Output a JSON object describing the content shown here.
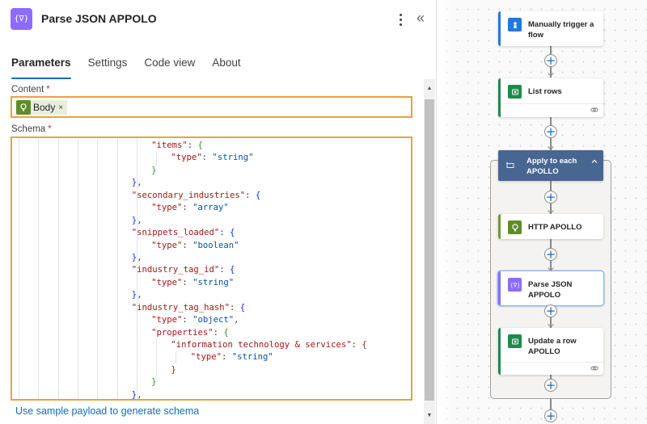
{
  "panel": {
    "title": "Parse JSON APPOLO",
    "icon": "braces-variable-icon",
    "more_icon": "more-vertical-icon",
    "collapse_icon": "double-chevron-left-icon",
    "collapse_glyph": "«",
    "tabs": [
      {
        "label": "Parameters",
        "active": true
      },
      {
        "label": "Settings",
        "active": false
      },
      {
        "label": "Code view",
        "active": false
      },
      {
        "label": "About",
        "active": false
      }
    ],
    "content": {
      "label": "Content",
      "required_mark": "*",
      "token": {
        "label": "Body",
        "remove": "×",
        "icon": "http-globe-icon"
      }
    },
    "schema": {
      "label": "Schema",
      "required_mark": "*",
      "lines": [
        {
          "indent": 7,
          "parts": [
            [
              "k",
              "\"items\""
            ],
            [
              "p",
              ": "
            ],
            [
              "b2",
              "{"
            ]
          ]
        },
        {
          "indent": 8,
          "parts": [
            [
              "k",
              "\"type\""
            ],
            [
              "p",
              ": "
            ],
            [
              "s",
              "\"string\""
            ]
          ]
        },
        {
          "indent": 7,
          "parts": [
            [
              "b2",
              "}"
            ]
          ]
        },
        {
          "indent": 6,
          "parts": [
            [
              "b1",
              "}"
            ],
            [
              "p",
              ","
            ]
          ]
        },
        {
          "indent": 6,
          "parts": [
            [
              "k",
              "\"secondary_industries\""
            ],
            [
              "p",
              ": "
            ],
            [
              "b1",
              "{"
            ]
          ]
        },
        {
          "indent": 7,
          "parts": [
            [
              "k",
              "\"type\""
            ],
            [
              "p",
              ": "
            ],
            [
              "s",
              "\"array\""
            ]
          ]
        },
        {
          "indent": 6,
          "parts": [
            [
              "b1",
              "}"
            ],
            [
              "p",
              ","
            ]
          ]
        },
        {
          "indent": 6,
          "parts": [
            [
              "k",
              "\"snippets_loaded\""
            ],
            [
              "p",
              ": "
            ],
            [
              "b1",
              "{"
            ]
          ]
        },
        {
          "indent": 7,
          "parts": [
            [
              "k",
              "\"type\""
            ],
            [
              "p",
              ": "
            ],
            [
              "s",
              "\"boolean\""
            ]
          ]
        },
        {
          "indent": 6,
          "parts": [
            [
              "b1",
              "}"
            ],
            [
              "p",
              ","
            ]
          ]
        },
        {
          "indent": 6,
          "parts": [
            [
              "k",
              "\"industry_tag_id\""
            ],
            [
              "p",
              ": "
            ],
            [
              "b1",
              "{"
            ]
          ]
        },
        {
          "indent": 7,
          "parts": [
            [
              "k",
              "\"type\""
            ],
            [
              "p",
              ": "
            ],
            [
              "s",
              "\"string\""
            ]
          ]
        },
        {
          "indent": 6,
          "parts": [
            [
              "b1",
              "}"
            ],
            [
              "p",
              ","
            ]
          ]
        },
        {
          "indent": 6,
          "parts": [
            [
              "k",
              "\"industry_tag_hash\""
            ],
            [
              "p",
              ": "
            ],
            [
              "b1",
              "{"
            ]
          ]
        },
        {
          "indent": 7,
          "parts": [
            [
              "k",
              "\"type\""
            ],
            [
              "p",
              ": "
            ],
            [
              "s",
              "\"object\""
            ],
            [
              "p",
              ","
            ]
          ]
        },
        {
          "indent": 7,
          "parts": [
            [
              "k",
              "\"properties\""
            ],
            [
              "p",
              ": "
            ],
            [
              "b2",
              "{"
            ]
          ]
        },
        {
          "indent": 8,
          "parts": [
            [
              "k",
              "\"information technology & services\""
            ],
            [
              "p",
              ": "
            ],
            [
              "b3",
              "{"
            ]
          ]
        },
        {
          "indent": 9,
          "parts": [
            [
              "k",
              "\"type\""
            ],
            [
              "p",
              ": "
            ],
            [
              "s",
              "\"string\""
            ]
          ]
        },
        {
          "indent": 8,
          "parts": [
            [
              "b3",
              "}"
            ]
          ]
        },
        {
          "indent": 7,
          "parts": [
            [
              "b2",
              "}"
            ]
          ]
        },
        {
          "indent": 6,
          "parts": [
            [
              "b1",
              "}"
            ],
            [
              "p",
              ","
            ]
          ]
        }
      ]
    },
    "generate_link": "Use sample payload to generate schema",
    "scrollbar": {
      "up": "▲",
      "down": "▼"
    }
  },
  "flow": {
    "nodes": [
      {
        "id": "trigger",
        "title": "Manually trigger a flow",
        "icon": "manual-trigger-icon",
        "accent": "#1f7ae0",
        "icon_bg": "#1f7ae0",
        "has_footer": false
      },
      {
        "id": "list-rows",
        "title": "List rows",
        "icon": "excel-icon",
        "accent": "#1e8a4c",
        "icon_bg": "#1e8a4c",
        "has_footer": true
      },
      {
        "id": "http-apollo",
        "title": "HTTP APOLLO",
        "icon": "http-globe-icon",
        "accent": "#6b9a33",
        "icon_bg": "#5e8c2a",
        "has_footer": false
      },
      {
        "id": "parse-json-appolo",
        "title": "Parse JSON APPOLO",
        "icon": "braces-variable-icon",
        "accent": "#8c6cff",
        "icon_bg": "#8c6cff",
        "has_footer": false,
        "selected": true
      },
      {
        "id": "update-row",
        "title": "Update a row APOLLO",
        "icon": "excel-icon",
        "accent": "#1e8a4c",
        "icon_bg": "#1e8a4c",
        "has_footer": true
      }
    ],
    "loop": {
      "title": "Apply to each APOLLO",
      "icon": "loop-icon",
      "collapse_icon": "chevron-up-icon",
      "color": "#476692"
    },
    "add_glyph": "+"
  }
}
